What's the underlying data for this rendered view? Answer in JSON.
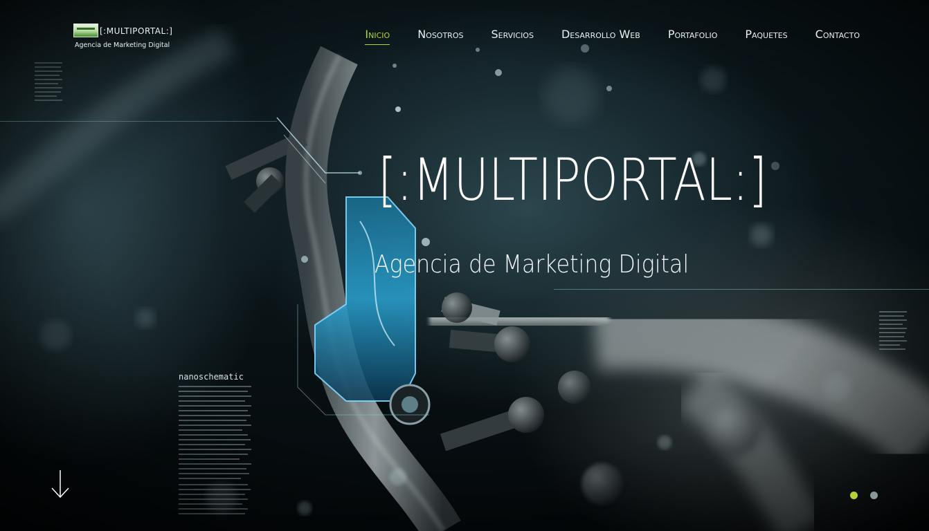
{
  "header": {
    "logo_title": "[:MULTIPORTAL:]",
    "logo_subtitle": "Agencia de Marketing Digital"
  },
  "nav": {
    "items": [
      {
        "label": "Inicio",
        "active": true
      },
      {
        "label": "Nosotros",
        "active": false
      },
      {
        "label": "Servicios",
        "active": false
      },
      {
        "label": "Desarrollo Web",
        "active": false
      },
      {
        "label": "Portafolio",
        "active": false
      },
      {
        "label": "Paquetes",
        "active": false
      },
      {
        "label": "Contacto",
        "active": false
      }
    ]
  },
  "hero": {
    "title": "[:MULTIPORTAL:]",
    "subtitle": "Agencia de Marketing Digital",
    "background_label": "nanoschematic"
  },
  "slider": {
    "slides": 2,
    "active_index": 0
  },
  "icons": {
    "scroll": "arrow-down-icon"
  },
  "colors": {
    "accent": "#b5d334",
    "text": "#ffffff",
    "dot_inactive": "#8a9a9c"
  }
}
